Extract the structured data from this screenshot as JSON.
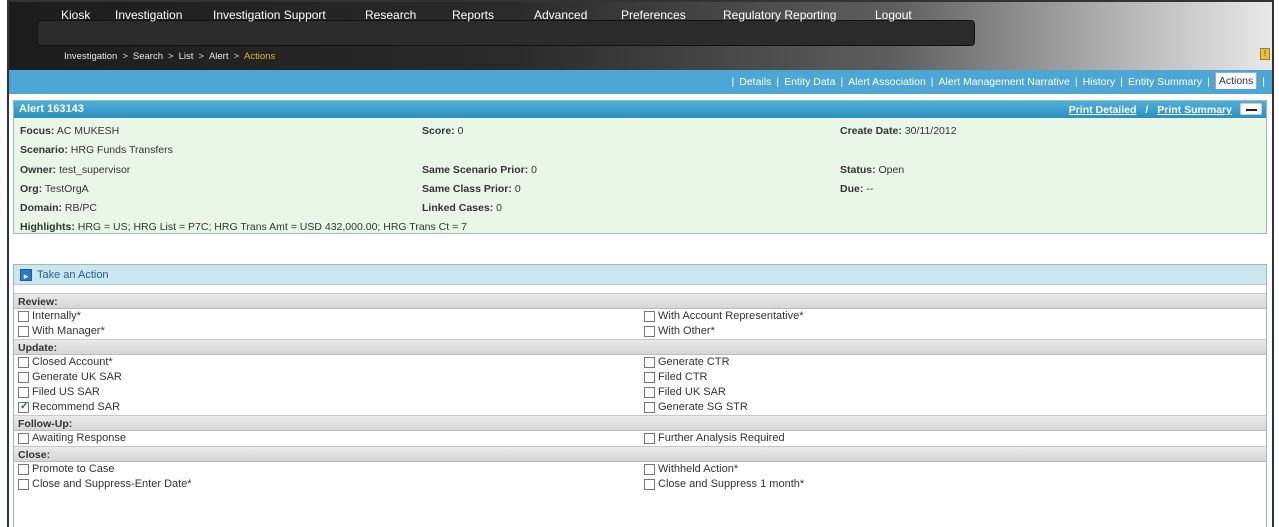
{
  "menu": {
    "items": [
      "Kiosk",
      "Investigation",
      "Investigation Support",
      "Research",
      "Reports",
      "Advanced",
      "Preferences",
      "Regulatory Reporting",
      "Logout"
    ]
  },
  "breadcrumb": {
    "items": [
      "Investigation",
      "Search",
      "List",
      "Alert"
    ],
    "current": "Actions",
    "separator": ">"
  },
  "alert_icon": "notification-icon",
  "tabs": {
    "items": [
      "Details",
      "Entity Data",
      "Alert Association",
      "Alert Management Narrative",
      "History",
      "Entity Summary",
      "Actions"
    ],
    "active": "Actions"
  },
  "alert": {
    "title": "Alert 163143",
    "print_detailed": "Print Detailed",
    "print_separator": "/",
    "print_summary": "Print Summary",
    "focus": {
      "label": "Focus:",
      "value": "AC MUKESH"
    },
    "score": {
      "label": "Score:",
      "value": "0"
    },
    "create_date": {
      "label": "Create Date:",
      "value": "30/11/2012"
    },
    "scenario": {
      "label": "Scenario:",
      "value": "HRG Funds Transfers"
    },
    "owner": {
      "label": "Owner:",
      "value": "test_supervisor"
    },
    "same_scenario_prior": {
      "label": "Same Scenario Prior:",
      "value": "0"
    },
    "status": {
      "label": "Status:",
      "value": "Open"
    },
    "org": {
      "label": "Org:",
      "value": "TestOrgA"
    },
    "same_class_prior": {
      "label": "Same Class Prior:",
      "value": "0"
    },
    "due": {
      "label": "Due:",
      "value": "--"
    },
    "domain": {
      "label": "Domain:",
      "value": "RB/PC"
    },
    "linked_cases": {
      "label": "Linked Cases:",
      "value": "0"
    },
    "highlights": {
      "label": "Highlights:",
      "value": "HRG = US; HRG List = P7C; HRG Trans Amt = USD 432,000.00; HRG Trans Ct = 7"
    }
  },
  "actions": {
    "title": "Take an Action",
    "review_label": "Review:",
    "review": [
      {
        "left": "Internally*",
        "right": "With Account Representative*"
      },
      {
        "left": "With Manager*",
        "right": "With Other*"
      }
    ],
    "update_label": "Update:",
    "update": [
      {
        "left": "Closed Account*",
        "right": "Generate CTR"
      },
      {
        "left": "Generate UK SAR",
        "right": "Filed CTR"
      },
      {
        "left": "Filed US SAR",
        "right": "Filed UK SAR"
      },
      {
        "left": "Recommend SAR",
        "right": "Generate SG STR",
        "left_checked": true
      }
    ],
    "followup_label": "Follow-Up:",
    "followup": [
      {
        "left": "Awaiting Response",
        "right": "Further Analysis Required"
      }
    ],
    "close_label": "Close:",
    "close": [
      {
        "left": "Promote to Case",
        "right": "Withheld Action*"
      },
      {
        "left": "Close and Suppress-Enter Date*",
        "right": "Close and Suppress 1 month*"
      }
    ]
  }
}
